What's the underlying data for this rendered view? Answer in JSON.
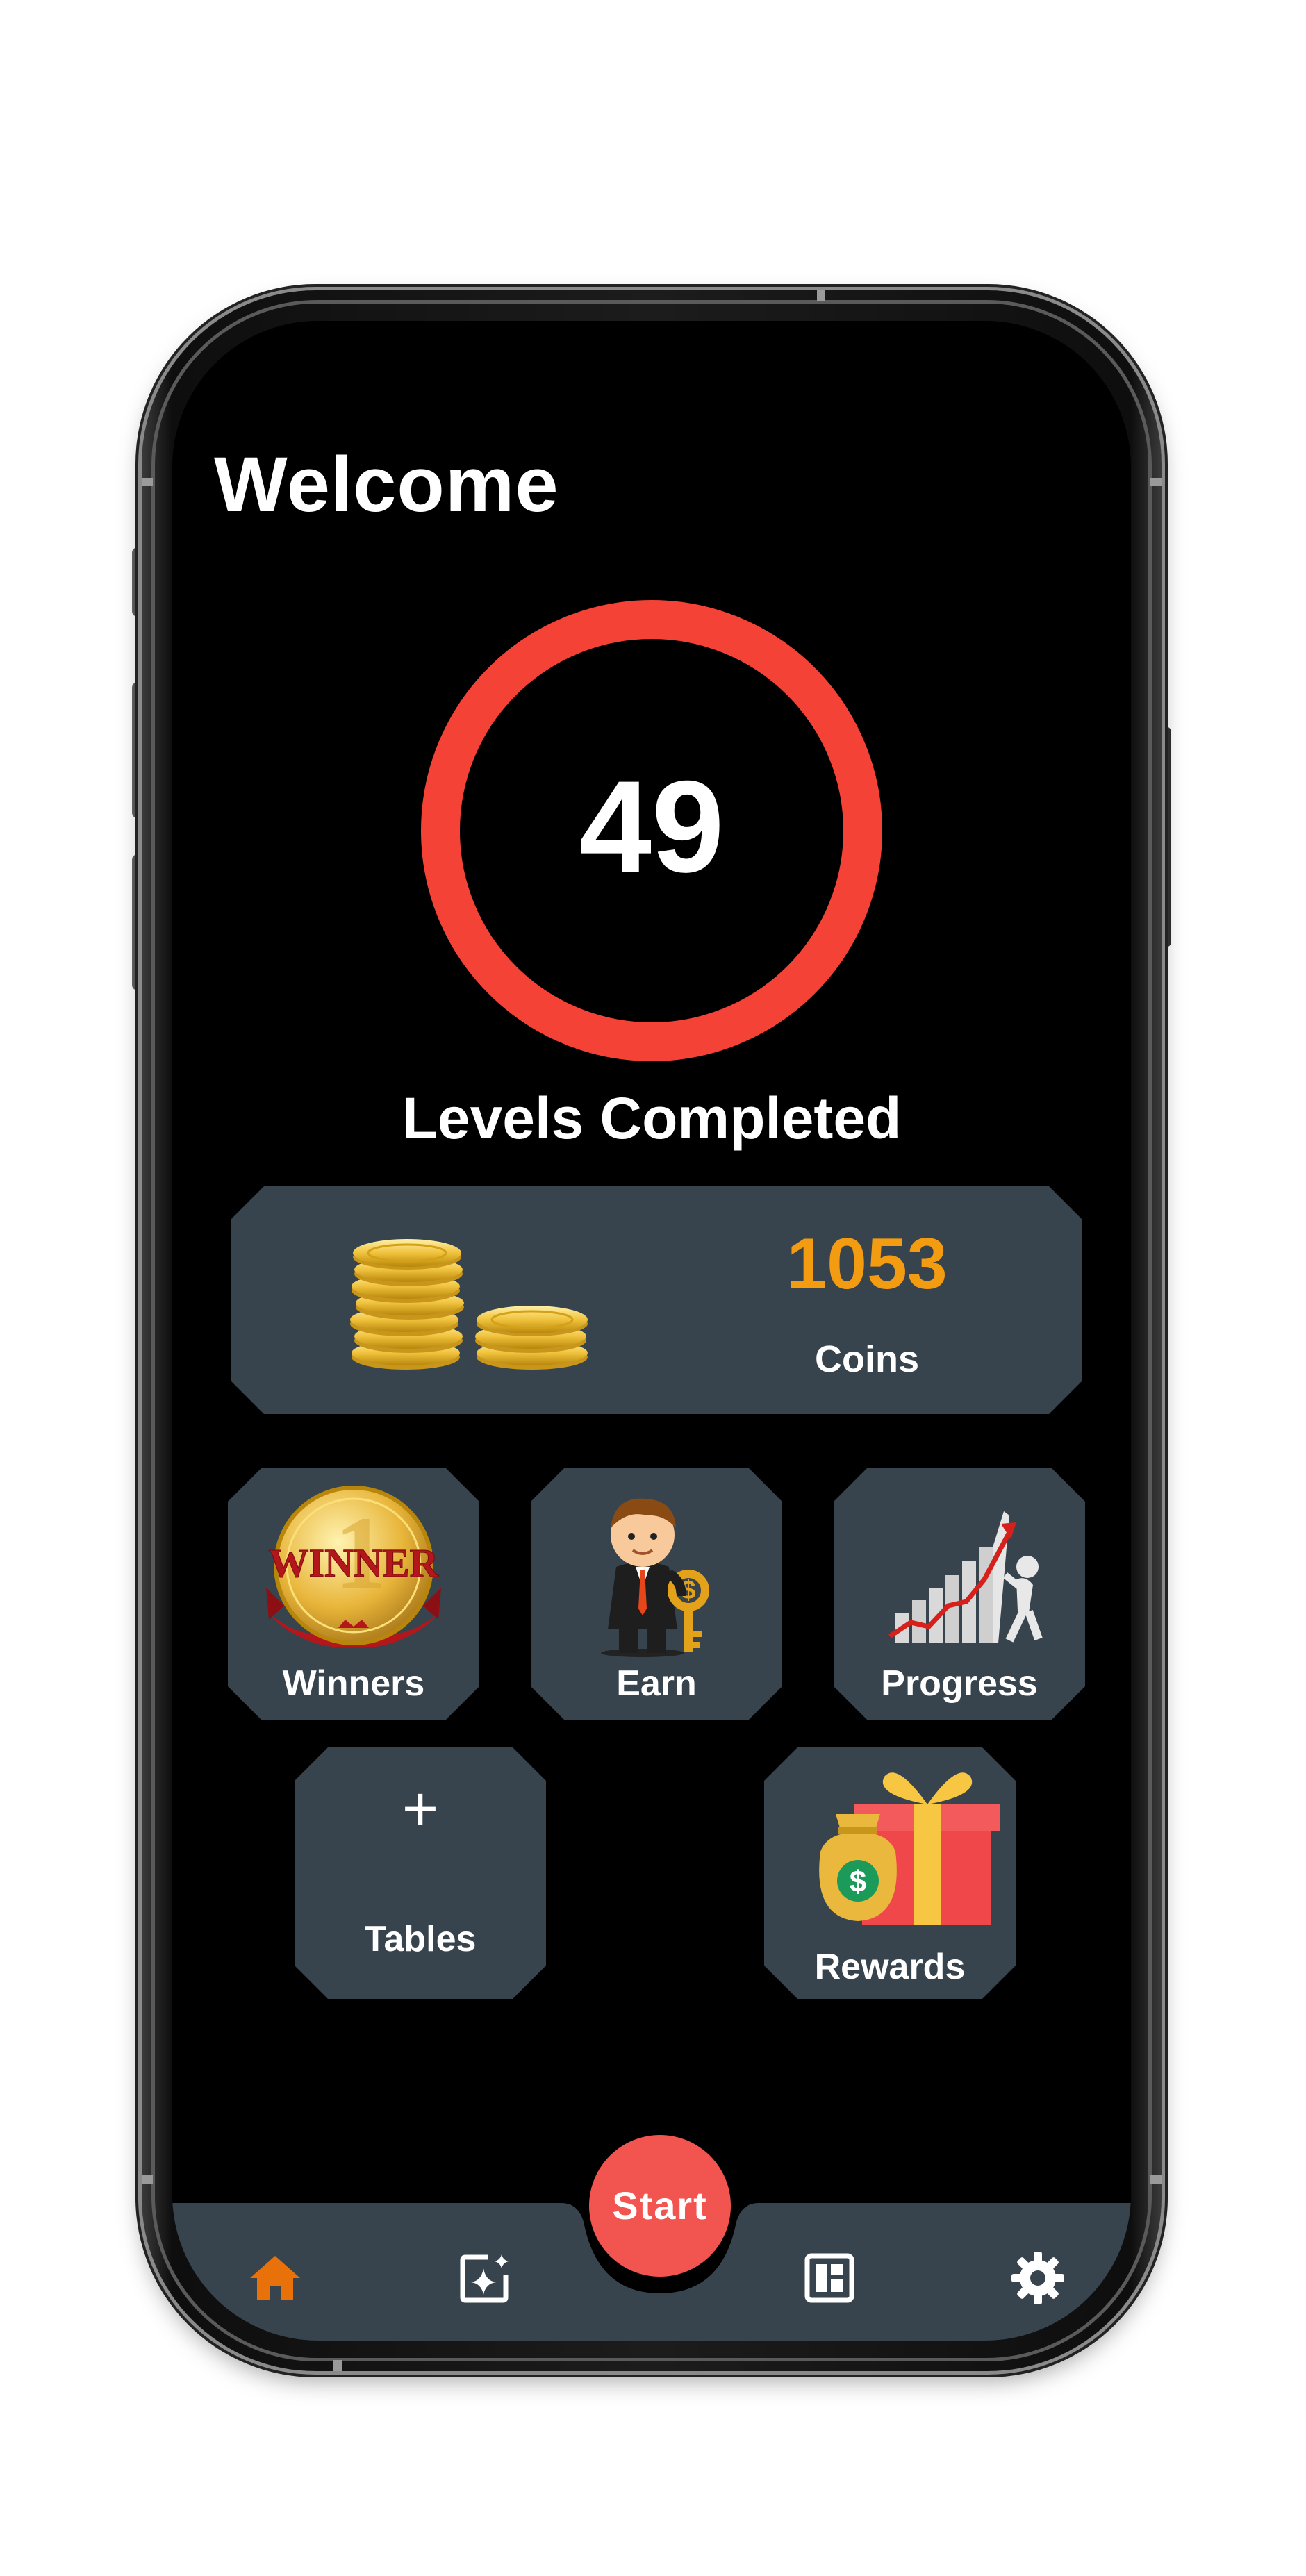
{
  "header": {
    "title": "Welcome"
  },
  "levels": {
    "count": "49",
    "label": "Levels Completed",
    "ring_color": "#f44336"
  },
  "coins": {
    "value": "1053",
    "label": "Coins",
    "value_color": "#f39c12"
  },
  "tiles": [
    {
      "id": "winners",
      "label": "Winners",
      "badge_text": "WINNER"
    },
    {
      "id": "earn",
      "label": "Earn"
    },
    {
      "id": "progress",
      "label": "Progress"
    },
    {
      "id": "tables",
      "label": "Tables",
      "icon": "plus-icon"
    },
    {
      "id": "rewards",
      "label": "Rewards"
    }
  ],
  "bottom_nav": {
    "items": [
      {
        "id": "home",
        "icon": "home-icon",
        "active": true
      },
      {
        "id": "sparkle",
        "icon": "sparkle-icon",
        "active": false
      },
      {
        "id": "start",
        "label": "Start",
        "color": "#f2544f"
      },
      {
        "id": "dashboard",
        "icon": "dashboard-icon",
        "active": false
      },
      {
        "id": "settings",
        "icon": "gear-icon",
        "active": false
      }
    ],
    "active_color": "#e8710a"
  },
  "colors": {
    "background": "#000000",
    "card": "#37444d",
    "text": "#ffffff"
  }
}
